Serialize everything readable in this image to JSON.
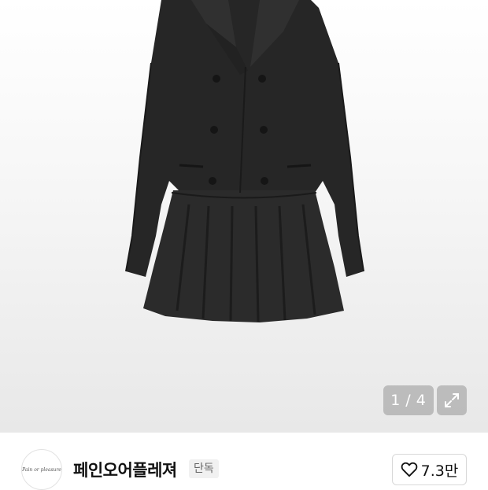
{
  "gallery": {
    "current": "1",
    "separator": "/",
    "total": "4",
    "expand_icon": "expand-arrows-icon"
  },
  "store": {
    "avatar_text": "Pain or pleasure",
    "name": "페인오어플레져",
    "badge": "단독"
  },
  "like": {
    "icon": "heart-outline-icon",
    "count": "7.3만"
  }
}
